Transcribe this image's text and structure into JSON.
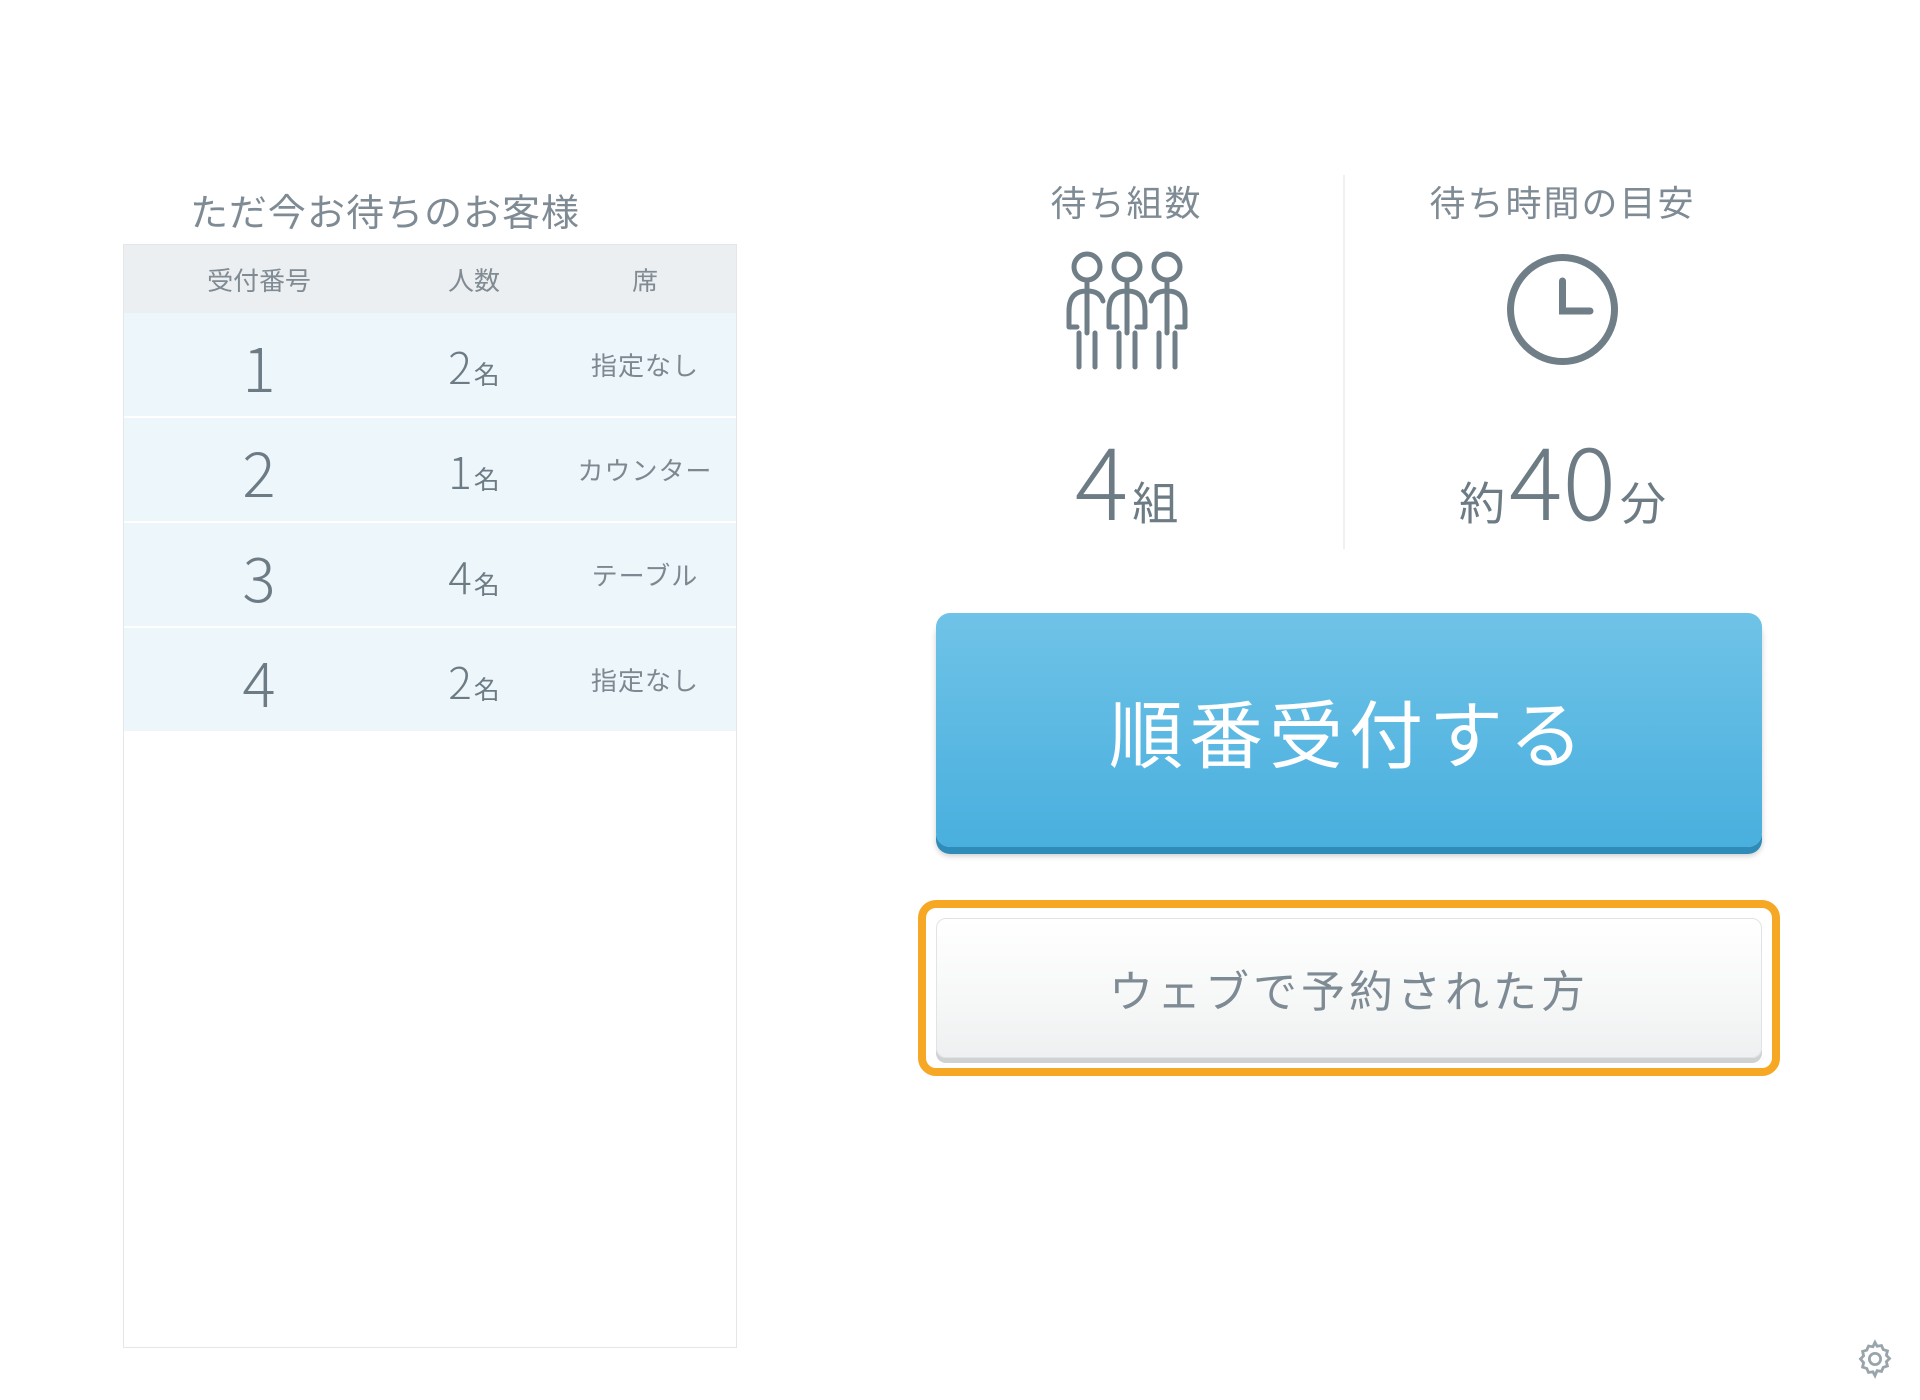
{
  "waitlist": {
    "title": "ただ今お待ちのお客様",
    "headers": {
      "number": "受付番号",
      "count": "人数",
      "seat": "席"
    },
    "rows": [
      {
        "number": "1",
        "count": "2",
        "count_unit": "名",
        "seat": "指定なし"
      },
      {
        "number": "2",
        "count": "1",
        "count_unit": "名",
        "seat": "カウンター"
      },
      {
        "number": "3",
        "count": "4",
        "count_unit": "名",
        "seat": "テーブル"
      },
      {
        "number": "4",
        "count": "2",
        "count_unit": "名",
        "seat": "指定なし"
      }
    ]
  },
  "stats": {
    "groups": {
      "label": "待ち組数",
      "value": "4",
      "unit": "組"
    },
    "wait_time": {
      "label": "待ち時間の目安",
      "prefix": "約",
      "value": "40",
      "unit": "分"
    }
  },
  "buttons": {
    "primary": "順番受付する",
    "secondary": "ウェブで予約された方"
  }
}
